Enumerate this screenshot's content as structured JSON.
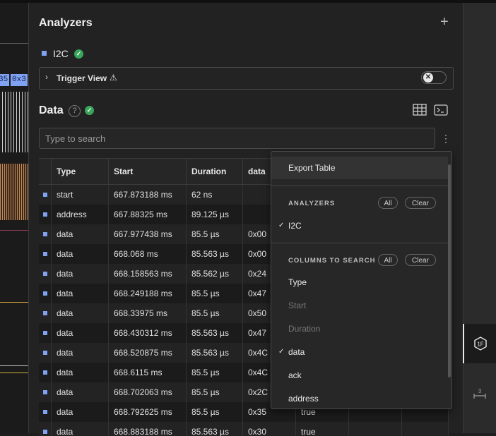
{
  "wave": {
    "tag1": "35",
    "tag2": "0x3"
  },
  "analyzers": {
    "title": "Analyzers",
    "add_icon": "plus-icon",
    "item": {
      "name": "I2C",
      "status": "ok"
    },
    "trigger_view": {
      "label": "Trigger View",
      "warning_icon": "warning-icon",
      "toggle_on": false
    }
  },
  "data_section": {
    "title": "Data",
    "search_placeholder": "Type to search",
    "columns": [
      "Type",
      "Start",
      "Duration",
      "data"
    ],
    "rows": [
      [
        "start",
        "667.873188 ms",
        "62 ns",
        ""
      ],
      [
        "address",
        "667.88325 ms",
        "89.125 µs",
        ""
      ],
      [
        "data",
        "667.977438 ms",
        "85.5 µs",
        "0x00"
      ],
      [
        "data",
        "668.068 ms",
        "85.563 µs",
        "0x00"
      ],
      [
        "data",
        "668.158563 ms",
        "85.562 µs",
        "0x24"
      ],
      [
        "data",
        "668.249188 ms",
        "85.5 µs",
        "0x47"
      ],
      [
        "data",
        "668.33975 ms",
        "85.5 µs",
        "0x50"
      ],
      [
        "data",
        "668.430312 ms",
        "85.563 µs",
        "0x47"
      ],
      [
        "data",
        "668.520875 ms",
        "85.563 µs",
        "0x4C"
      ],
      [
        "data",
        "668.6115 ms",
        "85.5 µs",
        "0x4C"
      ],
      [
        "data",
        "668.702063 ms",
        "85.5 µs",
        "0x2C"
      ],
      [
        "data",
        "668.792625 ms",
        "85.5 µs",
        "0x35",
        "true"
      ],
      [
        "data",
        "668.883188 ms",
        "85.563 µs",
        "0x30",
        "true"
      ]
    ]
  },
  "menu": {
    "export": "Export Table",
    "analyzers_header": "ANALYZERS",
    "all": "All",
    "clear": "Clear",
    "analyzers": [
      {
        "label": "I2C",
        "checked": true
      }
    ],
    "columns_header": "COLUMNS TO SEARCH",
    "columns": [
      {
        "label": "Type",
        "checked": false,
        "disabled": false
      },
      {
        "label": "Start",
        "checked": false,
        "disabled": true
      },
      {
        "label": "Duration",
        "checked": false,
        "disabled": true
      },
      {
        "label": "data",
        "checked": true,
        "disabled": false
      },
      {
        "label": "ack",
        "checked": false,
        "disabled": false
      },
      {
        "label": "address",
        "checked": false,
        "disabled": false
      }
    ]
  },
  "sidebar": {
    "active_icon": "hex-1f-icon",
    "active_label": "1F",
    "second_icon": "timing-marker-icon",
    "second_label": "3"
  }
}
